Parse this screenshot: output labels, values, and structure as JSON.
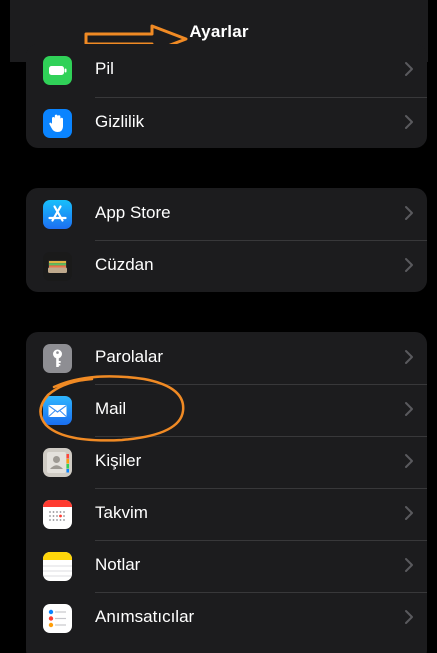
{
  "navbar": {
    "title": "Ayarlar"
  },
  "group1": [
    {
      "label": "Pil",
      "icon": "battery-icon"
    },
    {
      "label": "Gizlilik",
      "icon": "hand-privacy-icon"
    }
  ],
  "group2": [
    {
      "label": "App Store",
      "icon": "app-store-icon"
    },
    {
      "label": "Cüzdan",
      "icon": "wallet-icon"
    }
  ],
  "group3": [
    {
      "label": "Parolalar",
      "icon": "key-icon"
    },
    {
      "label": "Mail",
      "icon": "mail-icon"
    },
    {
      "label": "Kişiler",
      "icon": "contacts-icon"
    },
    {
      "label": "Takvim",
      "icon": "calendar-icon"
    },
    {
      "label": "Notlar",
      "icon": "notes-icon"
    },
    {
      "label": "Anımsatıcılar",
      "icon": "reminders-icon"
    }
  ],
  "colors": {
    "background": "#000000",
    "cell": "#1c1c1e",
    "separator": "#38383a",
    "chevron": "#5a5a5e",
    "annotation": "#f08a24",
    "battery_green": "#30d158",
    "privacy_blue": "#0a84ff",
    "mail_blue": "#1f8cf5"
  }
}
